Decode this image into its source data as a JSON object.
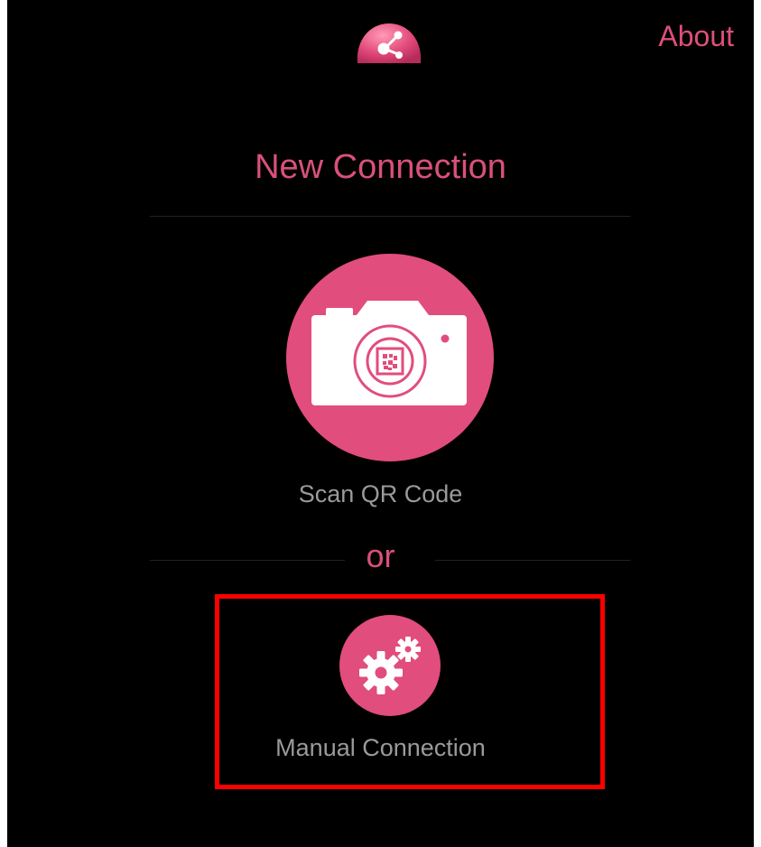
{
  "header": {
    "logo_icon": "app-logo-icon",
    "about_label": "About"
  },
  "page": {
    "title": "New Connection"
  },
  "scan": {
    "icon": "camera-qr-icon",
    "label": "Scan QR Code"
  },
  "separator": {
    "label": "or"
  },
  "manual": {
    "icon": "gears-icon",
    "label": "Manual Connection"
  },
  "colors": {
    "background": "#000000",
    "accent": "#e14d7c",
    "accent_text": "#d9517a",
    "label_text": "#9a9a9a",
    "highlight": "#ff0000"
  }
}
